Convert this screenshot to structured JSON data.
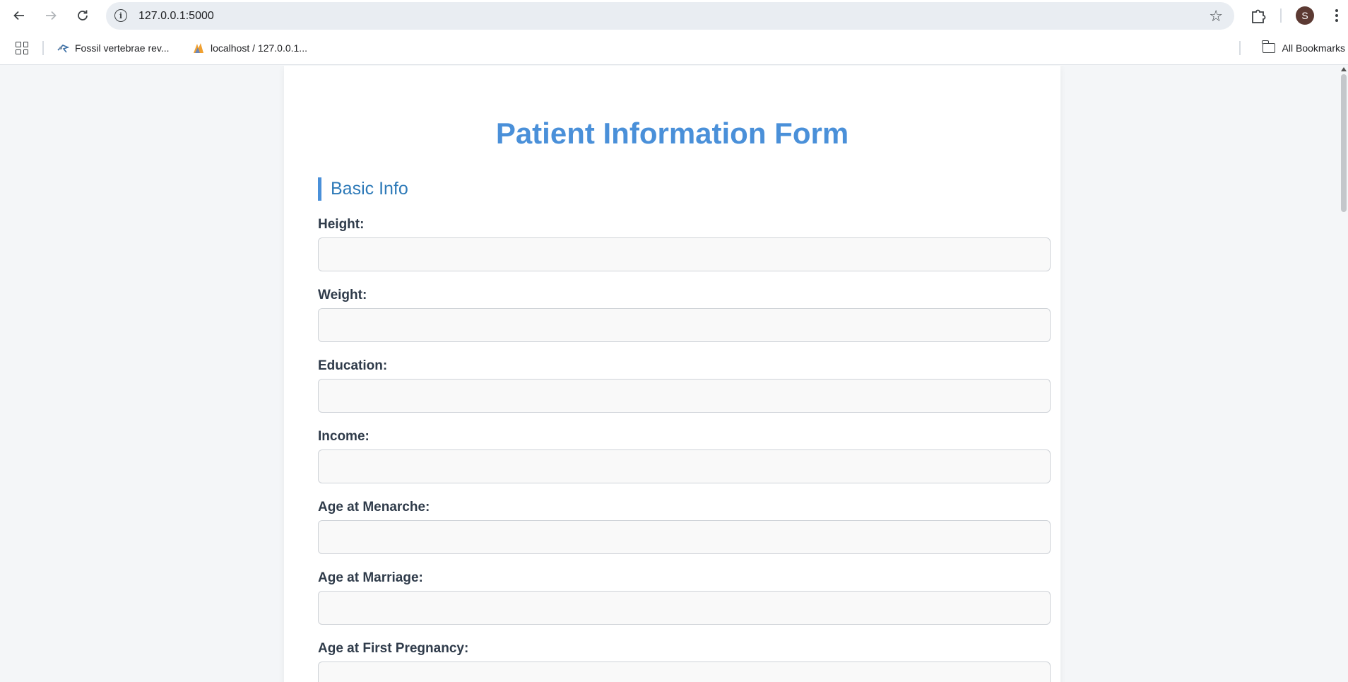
{
  "browser": {
    "url": "127.0.0.1:5000",
    "profile_initial": "S",
    "bookmarks": [
      {
        "label": "Fossil vertebrae rev..."
      },
      {
        "label": "localhost / 127.0.0.1..."
      }
    ],
    "all_bookmarks_label": "All Bookmarks"
  },
  "page": {
    "title": "Patient Information Form",
    "section": "Basic Info",
    "fields": [
      {
        "label": "Height:",
        "value": ""
      },
      {
        "label": "Weight:",
        "value": ""
      },
      {
        "label": "Education:",
        "value": ""
      },
      {
        "label": "Income:",
        "value": ""
      },
      {
        "label": "Age at Menarche:",
        "value": ""
      },
      {
        "label": "Age at Marriage:",
        "value": ""
      },
      {
        "label": "Age at First Pregnancy:",
        "value": ""
      }
    ]
  },
  "colors": {
    "accent": "#4a90d9",
    "section_text": "#2e7ab8",
    "label_text": "#2f3b4a",
    "page_bg": "#f4f6f8",
    "avatar_bg": "#5c3a33"
  }
}
